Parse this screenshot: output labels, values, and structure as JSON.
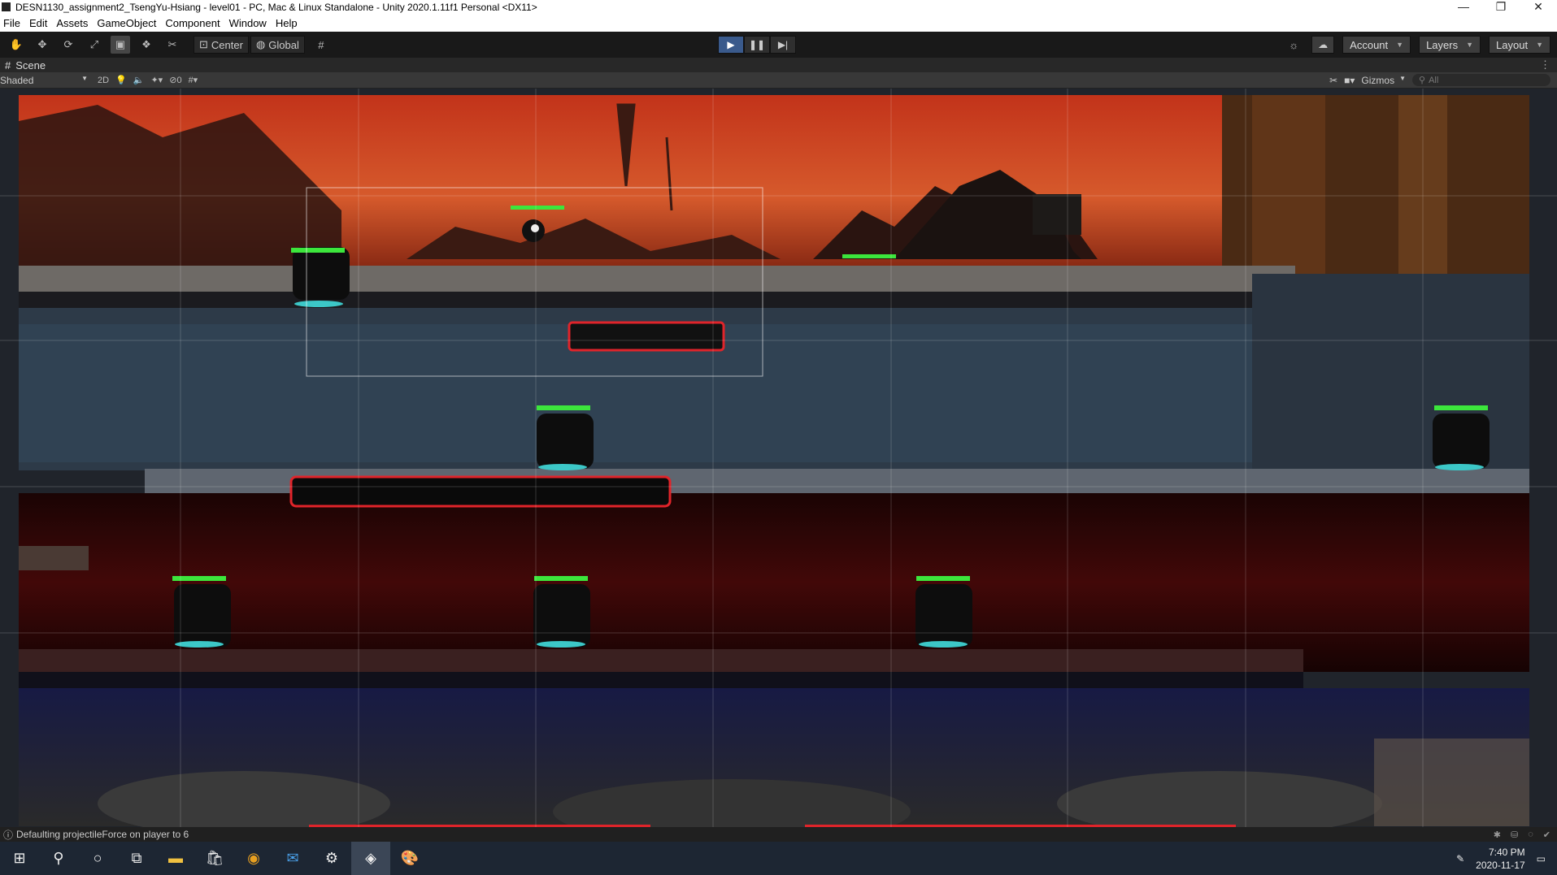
{
  "window": {
    "title": "DESN1130_assignment2_TsengYu-Hsiang - level01 - PC, Mac & Linux Standalone - Unity 2020.1.11f1 Personal <DX11>",
    "controls": [
      "—",
      "❐",
      "✕"
    ]
  },
  "menu": [
    "File",
    "Edit",
    "Assets",
    "GameObject",
    "Component",
    "Window",
    "Help"
  ],
  "toolbar": {
    "pivot": "Center",
    "space": "Global",
    "account": "Account",
    "layers": "Layers",
    "layout": "Layout"
  },
  "scene": {
    "tab_label": "Scene",
    "draw_mode": "Shaded",
    "mode_2d": "2D",
    "hidden_count": "0",
    "gizmos": "Gizmos",
    "search_placeholder": "All"
  },
  "status": {
    "message": "Defaulting projectileForce on player to 6"
  },
  "taskbar": {
    "time": "7:40 PM",
    "date": "2020-11-17"
  }
}
